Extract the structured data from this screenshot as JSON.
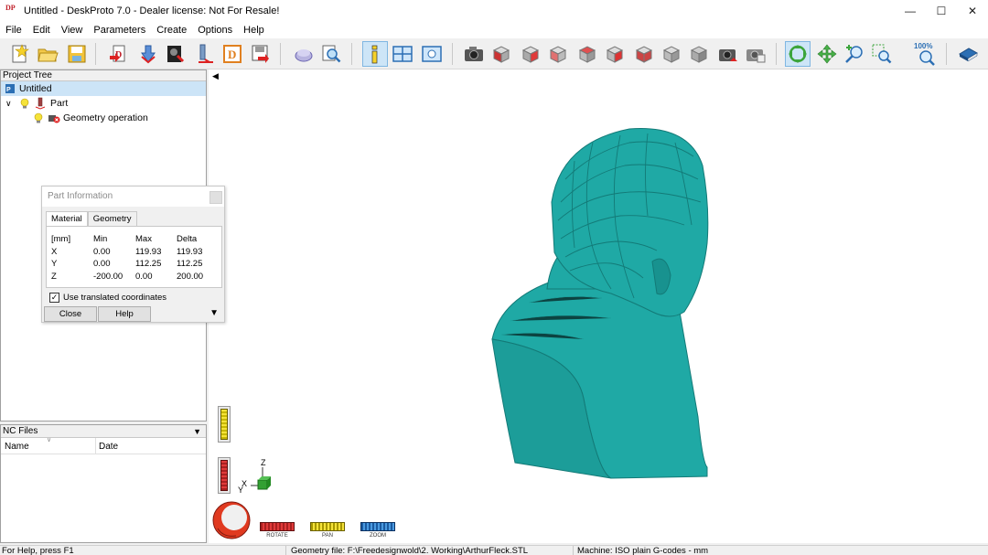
{
  "window": {
    "title": "Untitled - DeskProto 7.0 - Dealer license: Not For Resale!",
    "logo_text": "DP"
  },
  "menu": [
    "File",
    "Edit",
    "View",
    "Parameters",
    "Create",
    "Options",
    "Help"
  ],
  "toolbar": {
    "icons": [
      "new-project-icon",
      "open-project-icon",
      "save-project-icon",
      "import-geometry-icon",
      "part-icon",
      "bitmap-icon",
      "vector-icon",
      "drawing-icon",
      "export-icon",
      "simulate-icon",
      "preview-icon",
      "info-icon",
      "tile-view-icon",
      "fit-view-icon",
      "camera-icon",
      "front-view-icon",
      "back-view-icon",
      "left-view-icon",
      "right-view-icon",
      "top-view-icon",
      "bottom-view-icon",
      "iso-view-icon",
      "side-view-icon",
      "reset-view-icon",
      "copy-view-icon",
      "rotate-icon",
      "pan-icon",
      "zoom-in-icon",
      "zoom-window-icon",
      "zoom-100-icon",
      "help-book-icon"
    ],
    "zoom_100_label": "100%"
  },
  "project_tree": {
    "header": "Project Tree",
    "root": "Untitled",
    "part": "Part",
    "operation": "Geometry operation"
  },
  "nc_files": {
    "header": "NC Files",
    "columns": [
      "Name",
      "Date"
    ]
  },
  "part_info": {
    "title": "Part Information",
    "tabs": [
      "Material",
      "Geometry"
    ],
    "header": [
      "[mm]",
      "Min",
      "Max",
      "Delta"
    ],
    "rows": [
      [
        "X",
        "0.00",
        "119.93",
        "119.93"
      ],
      [
        "Y",
        "0.00",
        "112.25",
        "112.25"
      ],
      [
        "Z",
        "-200.00",
        "0.00",
        "200.00"
      ]
    ],
    "checkbox_label": "Use translated coordinates",
    "checked": true,
    "close_button": "Close",
    "help_button": "Help"
  },
  "viewport": {
    "model_color": "#1fa9a5",
    "axis_labels": [
      "Z",
      "X",
      "Y"
    ],
    "mode_buttons": [
      "ROTATE",
      "PAN",
      "ZOOM"
    ]
  },
  "status": {
    "help": "For Help, press F1",
    "geometry_file": "Geometry file: F:\\Freedesignwold\\2. Working\\ArthurFleck.STL",
    "machine": "Machine: ISO plain G-codes - mm"
  }
}
